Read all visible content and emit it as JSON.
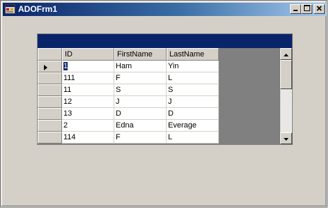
{
  "window": {
    "title": "ADOFrm1",
    "icon": "form-icon",
    "buttons": {
      "minimize": "minimize-icon",
      "maximize": "maximize-icon",
      "close": "close-icon"
    }
  },
  "grid": {
    "caption": "",
    "columns": [
      "ID",
      "FirstName",
      "LastName"
    ],
    "current_row_indicator": "right-triangle-icon",
    "rows": [
      [
        "1",
        "Ham",
        "Yin"
      ],
      [
        "111",
        "F",
        "L"
      ],
      [
        "11",
        "S",
        "S"
      ],
      [
        "12",
        "J",
        "J"
      ],
      [
        "13",
        "D",
        "D"
      ],
      [
        "2",
        "Edna",
        "Everage"
      ],
      [
        "114",
        "F",
        "L"
      ]
    ],
    "scrollbar": {
      "up": "scroll-up-arrow-icon",
      "down": "scroll-down-arrow-icon"
    }
  },
  "colors": {
    "title_gradient_start": "#0a246a",
    "title_gradient_end": "#a6caf0",
    "caption_bar": "#0a246a",
    "background": "#d4d0c8",
    "grid_empty_area": "#808080"
  }
}
